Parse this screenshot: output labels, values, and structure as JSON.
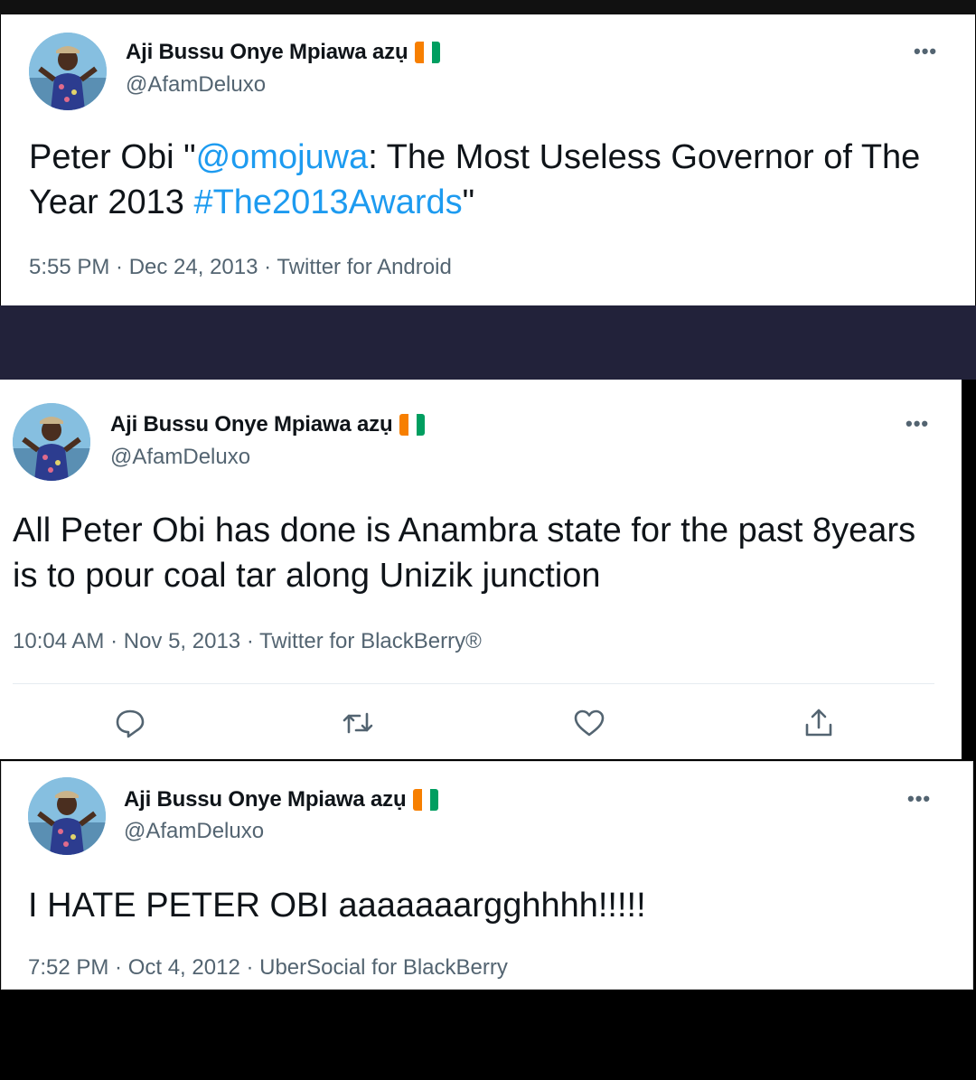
{
  "colors": {
    "link": "#1d9bf0",
    "flag_orange": "#f77f00",
    "flag_white": "#ffffff",
    "flag_green": "#009e60"
  },
  "tweets": [
    {
      "display_name": "Aji Bussu Onye Mpiawa azụ",
      "handle": "@AfamDeluxo",
      "more": "•••",
      "text_parts": [
        "Peter Obi \"",
        "@omojuwa",
        ": The Most Useless Governor of The Year 2013 ",
        "#The2013Awards",
        "\""
      ],
      "meta": "5:55 PM · Dec 24, 2013 · Twitter for Android"
    },
    {
      "display_name": "Aji Bussu Onye Mpiawa azụ",
      "handle": "@AfamDeluxo",
      "more": "•••",
      "text": "All Peter Obi has done is Anambra state for the past 8years is to pour coal tar along Unizik junction",
      "meta": "10:04 AM · Nov 5, 2013 · Twitter for BlackBerry®",
      "actions": [
        "reply-icon",
        "retweet-icon",
        "like-icon",
        "share-icon"
      ]
    },
    {
      "display_name": "Aji Bussu Onye Mpiawa azụ",
      "handle": "@AfamDeluxo",
      "more": "•••",
      "text": "I HATE PETER OBI aaaaaaargghhhh!!!!!",
      "meta": "7:52 PM · Oct 4, 2012 · UberSocial for BlackBerry"
    }
  ]
}
